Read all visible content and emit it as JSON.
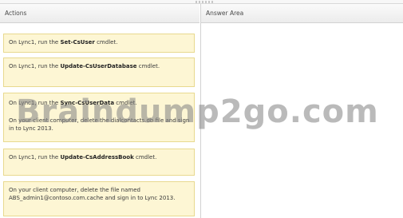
{
  "headers": {
    "actions": "Actions",
    "answer_area": "Answer Area"
  },
  "actions": [
    {
      "prefix": "On Lync1, run the ",
      "bold": "Set-CsUser",
      "suffix": " cmdlet."
    },
    {
      "prefix": "On Lync1, run the ",
      "bold": "Update-CsUserDatabase",
      "suffix": " cmdlet."
    },
    {
      "prefix": "On Lync1, run the ",
      "bold": "Sync-CsUserData",
      "suffix": " cmdlet.",
      "line2": "On your client computer, delete the dialcontacts.db file and sign in to Lync 2013."
    },
    {
      "prefix": "On Lync1, run the ",
      "bold": "Update-CsAddressBook",
      "suffix": " cmdlet."
    },
    {
      "text": "On your client computer, delete the file named ABS_admin1@contoso.com.cache and sign in to Lync 2013."
    }
  ],
  "watermark": "Braindump2go.com",
  "colors": {
    "item_bg": "#fdf6d4",
    "item_border": "#e8d98f",
    "header_bg": "#ececec"
  }
}
